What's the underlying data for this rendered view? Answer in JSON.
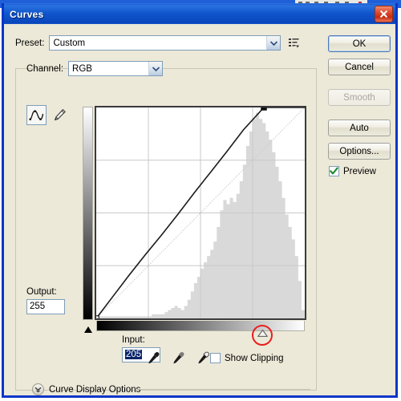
{
  "window": {
    "title": "Curves",
    "close_icon": "close-icon"
  },
  "preset": {
    "label": "Preset:",
    "value": "Custom",
    "menu_icon": "preset-menu-icon"
  },
  "channel": {
    "label": "Channel:",
    "value": "RGB"
  },
  "tools": {
    "curve_icon": "curve-tool-icon",
    "pencil_icon": "pencil-tool-icon"
  },
  "output": {
    "label": "Output:",
    "value": "255"
  },
  "input": {
    "label": "Input:",
    "value": "205"
  },
  "eyedroppers": [
    {
      "name": "black-point-eyedropper"
    },
    {
      "name": "gray-point-eyedropper"
    },
    {
      "name": "white-point-eyedropper"
    }
  ],
  "show_clipping": {
    "label": "Show Clipping",
    "checked": false
  },
  "curve_display_options": {
    "label": "Curve Display Options",
    "chevron_icon": "chevron-down-icon",
    "expanded": false
  },
  "buttons": {
    "ok": "OK",
    "cancel": "Cancel",
    "smooth": "Smooth",
    "auto": "Auto",
    "options": "Options..."
  },
  "preview": {
    "label": "Preview",
    "checked": true
  },
  "colors": {
    "title_bar": "#0f55cc",
    "dialog_face": "#ece9d8",
    "highlight_ring": "#e8201f",
    "selection_blue": "#0a246a",
    "histogram": "#d8d8d8",
    "curve_line": "#1a1a1a",
    "grid": "#c8c8c8"
  },
  "chart_data": {
    "type": "line",
    "title": "Curves tone response",
    "xlabel": "Input",
    "ylabel": "Output",
    "xlim": [
      0,
      255
    ],
    "ylim": [
      0,
      255
    ],
    "grid": true,
    "grid_divisions": 4,
    "legend": "none",
    "series": [
      {
        "name": "baseline-diagonal",
        "style": "dotted",
        "color": "#cccccc",
        "x": [
          0,
          255
        ],
        "y": [
          0,
          255
        ]
      },
      {
        "name": "tone-curve",
        "style": "solid",
        "color": "#1a1a1a",
        "x": [
          0,
          20,
          40,
          60,
          80,
          100,
          120,
          140,
          160,
          180,
          205,
          255
        ],
        "y": [
          0,
          26,
          52,
          77,
          101,
          126,
          152,
          177,
          202,
          228,
          255,
          255
        ]
      }
    ],
    "control_points": [
      {
        "input": 0,
        "output": 0
      },
      {
        "input": 205,
        "output": 255
      }
    ],
    "markers": {
      "black_input_marker": 0,
      "white_input_marker": 205
    },
    "histogram": {
      "color": "#d8d8d8",
      "bins": 64,
      "values": [
        1,
        1,
        1,
        1,
        1,
        1,
        1,
        1,
        1,
        1,
        1,
        1,
        1,
        1,
        1,
        1,
        1,
        2,
        2,
        2,
        2,
        3,
        4,
        5,
        6,
        5,
        4,
        6,
        9,
        13,
        17,
        20,
        24,
        27,
        30,
        33,
        37,
        44,
        52,
        57,
        55,
        58,
        56,
        60,
        66,
        74,
        83,
        90,
        96,
        99,
        96,
        94,
        90,
        86,
        80,
        73,
        66,
        58,
        50,
        44,
        38,
        30,
        18,
        4
      ],
      "peak_bins": [
        46,
        47,
        48,
        49,
        50
      ],
      "max_value": 100
    }
  }
}
